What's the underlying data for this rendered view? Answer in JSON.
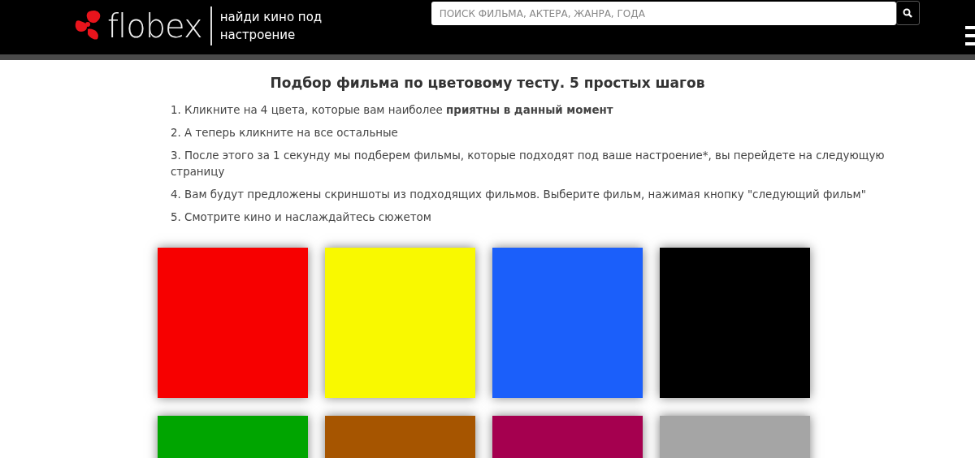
{
  "header": {
    "logo": "flobex",
    "tagline": "найди кино под настроение",
    "search": {
      "placeholder": "ПОИСК ФИЛЬМА, АКТЕРА, ЖАНРА, ГОДА"
    }
  },
  "title": "Подбор фильма по цветовому тесту. 5 простых шагов",
  "steps": [
    "1. Кликните на 4 цвета, которые вам наиболее **приятны в данный момент**",
    "2. А теперь кликните на все остальные",
    "3. После этого за 1 секунду мы подберем фильмы, которые подходят под ваше настроение*, вы перейдете на следующую страницу",
    "4. Вам будут предложены скриншоты из подходящих фильмов. Выберите фильм, нажимая кнопку \"следующий фильм\"",
    "5. Смотрите кино и наслаждайтесь сюжетом"
  ],
  "colors": [
    {
      "color": "#f70000"
    },
    {
      "color": "#f9f900"
    },
    {
      "color": "#1b5ffa"
    },
    {
      "color": "#000000"
    },
    {
      "color": "#00a500"
    },
    {
      "color": "#a65500"
    },
    {
      "color": "#a5004f"
    },
    {
      "color": "#a5a5a5"
    }
  ]
}
